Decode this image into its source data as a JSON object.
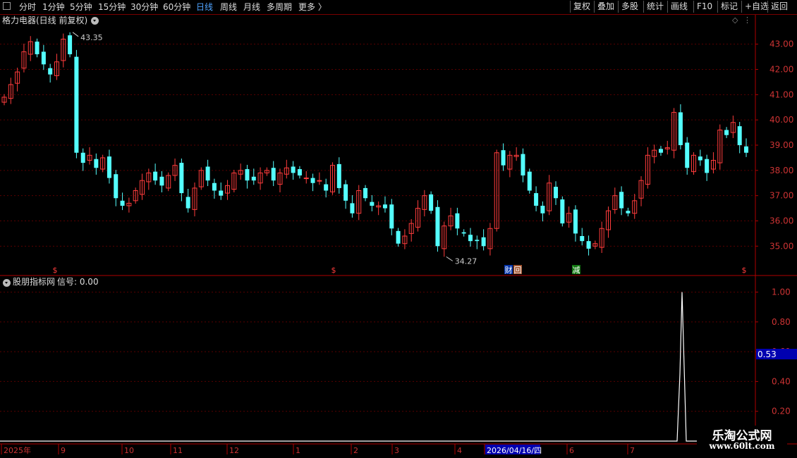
{
  "toolbar": {
    "periods": [
      "分时",
      "1分钟",
      "5分钟",
      "15分钟",
      "30分钟",
      "60分钟",
      "日线",
      "周线",
      "月线",
      "多周期",
      "更多 〉"
    ],
    "active_period": "日线",
    "right_buttons": [
      "复权",
      "叠加",
      "多股",
      "统计",
      "画线",
      "F10",
      "标记",
      "+自选",
      "返回"
    ]
  },
  "main_panel": {
    "title": "格力电器(日线 前复权)",
    "high_label": "43.35",
    "low_label": "34.27",
    "event_markers": [
      "$",
      "$",
      "财",
      "回",
      "减",
      "$"
    ],
    "axis_labels": [
      "43.00",
      "42.00",
      "41.00",
      "40.00",
      "39.00",
      "38.00",
      "37.00",
      "36.00",
      "35.00"
    ]
  },
  "indicator_panel": {
    "title": "股朋指标网",
    "signal_label": "信号: 0.00",
    "axis_labels": [
      "1.00",
      "0.80",
      "0.60",
      "0.40",
      "0.20"
    ],
    "current_value": "0.53"
  },
  "time_axis": {
    "labels": [
      "2025年",
      "9",
      "10",
      "11",
      "12",
      "1",
      "2",
      "3",
      "4",
      "2026/04/16/四",
      "6",
      "7"
    ]
  },
  "watermark": {
    "line1": "乐淘公式网",
    "line2": "www.60lt.com"
  },
  "colors": {
    "up": "#ff3c3c",
    "down": "#54ffff",
    "grid": "#5a0000",
    "border": "#b00000",
    "axis_text": "#cc3333",
    "highlight": "#0000b0"
  },
  "chart_data": {
    "type": "candlestick",
    "y_axis_range": [
      34.2,
      43.8
    ],
    "y_ticks": [
      35,
      36,
      37,
      38,
      39,
      40,
      41,
      42,
      43
    ],
    "indicator_range": [
      0,
      1.05
    ],
    "indicator_ticks": [
      0.2,
      0.4,
      0.6,
      0.8,
      1.0
    ],
    "indicator_peak": 1.0,
    "highest": 43.35,
    "lowest": 34.27,
    "closes": [
      40.9,
      41.4,
      41.9,
      42.7,
      43.1,
      42.6,
      42.2,
      41.8,
      42.3,
      43.2,
      42.6,
      38.7,
      38.3,
      38.6,
      38.1,
      38.5,
      37.7,
      36.9,
      36.6,
      36.7,
      37.2,
      37.6,
      37.9,
      37.6,
      37.4,
      37.8,
      38.2,
      37.1,
      36.5,
      37.3,
      38.0,
      37.6,
      37.2,
      37.0,
      37.4,
      37.9,
      38.0,
      37.6,
      37.6,
      37.9,
      38.0,
      37.6,
      37.9,
      38.1,
      37.9,
      37.8,
      37.7,
      37.5,
      37.6,
      37.2,
      38.2,
      37.3,
      36.8,
      36.3,
      37.2,
      36.9,
      36.6,
      36.6,
      36.5,
      35.7,
      35.1,
      35.4,
      35.9,
      36.5,
      37.0,
      36.4,
      35.0,
      35.8,
      36.2,
      35.7,
      35.5,
      35.2,
      35.2,
      35.0,
      35.7,
      38.7,
      38.2,
      38.6,
      38.6,
      37.8,
      37.2,
      36.6,
      36.3,
      37.5,
      36.9,
      35.9,
      36.3,
      35.5,
      35.2,
      34.9,
      35.1,
      35.7,
      36.4,
      37.0,
      36.5,
      36.3,
      36.8,
      37.6,
      38.6,
      38.8,
      38.7,
      38.9,
      40.3,
      39.0,
      38.1,
      38.6,
      38.4,
      37.9,
      38.4,
      39.6,
      39.4,
      39.9,
      39.0,
      38.7
    ]
  }
}
